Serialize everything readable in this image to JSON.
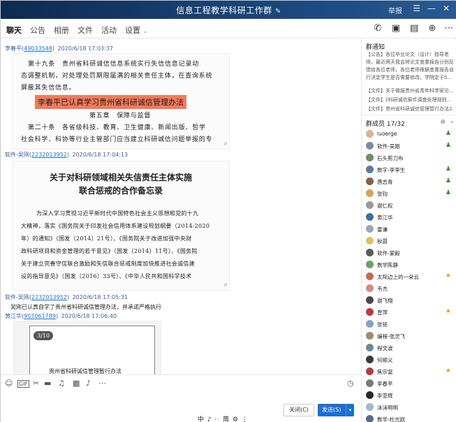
{
  "window": {
    "title": "信息工程教学科研工作群",
    "report_label": "举报"
  },
  "tabs": [
    "聊天",
    "公告",
    "相册",
    "文件",
    "活动",
    "设置"
  ],
  "messages": [
    {
      "sender": "李春平",
      "uid": "49033548",
      "time": "2020/6/18 17:03:37",
      "doc_lines": [
        "第十九条　贵州省科研诚信信息系统实行失信信息记录动",
        "态调整机制，对处理处罚期限届满的相关责任主体，在查询系统",
        "屏蔽其失信信息。"
      ],
      "highlight": "李春平已认真学习贵州省科研诚信管理办法",
      "chapter": "第五章　保障与监督",
      "doc_lines2": [
        "第二十条　各省级科技、教育、卫生健康、新闻出版、哲学",
        "社会科学、科协等行业主管部门应当建立科研诚信问题举报的专"
      ]
    },
    {
      "sender": "软件-吴刚",
      "uid": "2232013952",
      "time": "2020/6/18 17:04:13",
      "doc_title": [
        "关于对科研领域相关失信责任主体实施",
        "联合惩戒的合作备忘录"
      ],
      "doc_body": [
        "为深入学习贯彻习近平新时代中国特色社会主义思想和党的十九",
        "大精神，落实《国务院关于印发社会信用体系建设规划纲要（2014-2020",
        "年）的通知》（国发〔2014〕21号）、《国务院关于改进加强中央财",
        "政科研项目和资金管理的若干意见》（国发〔2014〕11号）、《国务院",
        "关于建立完善守信联合激励和失信联合惩戒制度加快推进社会诚信建",
        "设的指导意见》（国发〔2016〕33号）、《中华人民共和国科学技术"
      ]
    },
    {
      "sender": "软件-吴刚",
      "uid": "2232013952",
      "time": "2020/6/18 17:05:31",
      "text": "吴刚已认真自学了贵州省科研诚信管理办法，并承诺严格执行"
    },
    {
      "sender": "黄江华",
      "uid": "907061789",
      "time": "2020/6/18 17:06:40",
      "counter": "3/10",
      "doc_caption": "贵州省科研诚信管理暂行办法"
    }
  ],
  "input": {
    "close_label": "关闭(C)",
    "send_label": "发送(S)",
    "ime": "中 ♪ ⋅⋅ 简 ⚙ ⋮"
  },
  "notice": {
    "title": "群通知",
    "text": "【公告】各位毕业论文（设计）指导老师，最近两天我会将论文查重报告分别反馈给各位老师，各位老师根据查重报告自行决定学生是否需要修改，学院定于5...",
    "files": [
      "【文件】关于做报贵州省青年科学家论...",
      "【文件】《科研诚信案件调查处理规则...",
      "【文件】贵州省科研诚信管理暂行办法2..."
    ]
  },
  "members_header": "群成员 17/32",
  "members": [
    {
      "name": "luoerge",
      "role": "user",
      "color": "#d9b48f"
    },
    {
      "name": "软件-吴刚",
      "role": "user",
      "color": "#7b8da6"
    },
    {
      "name": "石头剪刀布",
      "role": "",
      "color": "#6b8f5e"
    },
    {
      "name": "数字-李李生",
      "role": "user",
      "color": "#5b7aa6"
    },
    {
      "name": "唐志青",
      "role": "user",
      "color": "#8a5e4a"
    },
    {
      "name": "张钧",
      "role": "user",
      "color": "#e0a050"
    },
    {
      "name": "谢仁权",
      "role": "",
      "color": "#999999"
    },
    {
      "name": "黄江华",
      "role": "",
      "color": "#3a6ea5"
    },
    {
      "name": "雷谦",
      "role": "",
      "color": "#9aa7b5"
    },
    {
      "name": "秋晨",
      "role": "",
      "color": "#e2c060"
    },
    {
      "name": "软件-蒙毅",
      "role": "",
      "color": "#5a5a5a"
    },
    {
      "name": "数学陈静",
      "role": "",
      "color": "#6aa06a"
    },
    {
      "name": "太阳边上的一朵云",
      "role": "admin",
      "color": "#c66a4a"
    },
    {
      "name": "韦杰",
      "role": "",
      "color": "#d48888"
    },
    {
      "name": "谢飞翔",
      "role": "",
      "color": "#4a4a4a"
    },
    {
      "name": "曾萍",
      "role": "admin",
      "color": "#c03a3a"
    },
    {
      "name": "张铭",
      "role": "",
      "color": "#8aa0c8"
    },
    {
      "name": "编程-张灵飞",
      "role": "",
      "color": "#a08a70"
    },
    {
      "name": "程文波",
      "role": "",
      "color": "#6a8a9a"
    },
    {
      "name": "何顺义",
      "role": "",
      "color": "#3a3a3a"
    },
    {
      "name": "焦宗富",
      "role": "admin",
      "color": "#b04040"
    },
    {
      "name": "李春平",
      "role": "",
      "color": "#7a7a7a"
    },
    {
      "name": "李亚辉",
      "role": "",
      "color": "#2a2a2a"
    },
    {
      "name": "沫沫明明",
      "role": "",
      "color": "#a0b8d0"
    },
    {
      "name": "数学-杜光跃",
      "role": "",
      "color": "#5a6a8a"
    }
  ]
}
